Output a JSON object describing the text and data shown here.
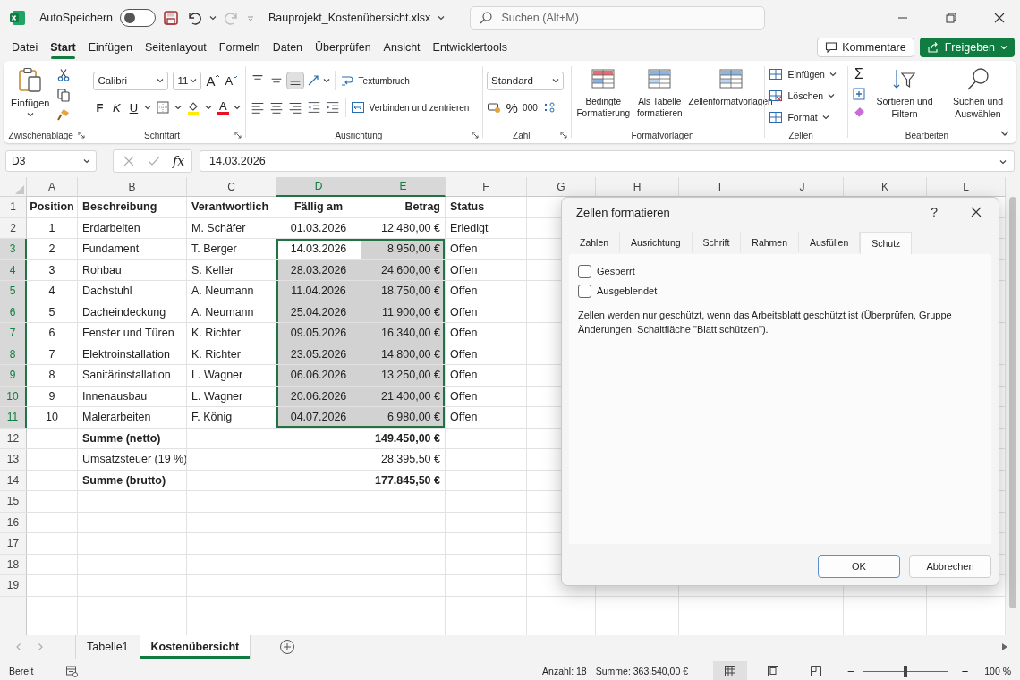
{
  "title_bar": {
    "autosave_label": "AutoSpeichern",
    "autosave_on": false,
    "filename": "Bauprojekt_Kostenübersicht.xlsx",
    "search_placeholder": "Suchen (Alt+M)"
  },
  "menu_tabs": [
    {
      "label": "Datei",
      "selected": false
    },
    {
      "label": "Start",
      "selected": true
    },
    {
      "label": "Einfügen",
      "selected": false
    },
    {
      "label": "Seitenlayout",
      "selected": false
    },
    {
      "label": "Formeln",
      "selected": false
    },
    {
      "label": "Daten",
      "selected": false
    },
    {
      "label": "Überprüfen",
      "selected": false
    },
    {
      "label": "Ansicht",
      "selected": false
    },
    {
      "label": "Entwicklertools",
      "selected": false
    }
  ],
  "comments_button": "Kommentare",
  "share_button": "Freigeben",
  "ribbon": {
    "clipboard": {
      "paste": "Einfügen",
      "label": "Zwischenablage"
    },
    "font": {
      "family": "Calibri",
      "size": "11",
      "grow": "A",
      "shrink": "A",
      "bold": "F",
      "italic": "K",
      "underline": "U",
      "color_letter": "A",
      "label": "Schriftart"
    },
    "alignment": {
      "vertical": [
        {
          "selected": false
        },
        {
          "selected": false
        },
        {
          "selected": true
        }
      ],
      "wrap": "Textumbruch",
      "merge": "Verbinden und zentrieren",
      "label": "Ausrichtung"
    },
    "number": {
      "format": "Standard",
      "percent": "%",
      "thousands": "000",
      "label": "Zahl"
    },
    "styles": {
      "buttons": [
        "Bedingte Formatierung",
        "Als Tabelle formatieren",
        "Zellenformatvorlagen"
      ],
      "label": "Formatvorlagen"
    },
    "cells": {
      "buttons": [
        "Einfügen",
        "Löschen",
        "Format"
      ],
      "label": "Zellen"
    },
    "editing": {
      "autosum": "Σ",
      "buttons": [
        "Sortieren und Filtern",
        "Suchen und Auswählen"
      ],
      "label": "Bearbeiten"
    }
  },
  "formula_bar": {
    "name_box": "D3",
    "fx": "fx",
    "value": "14.03.2026"
  },
  "grid": {
    "columns": [
      {
        "label": "A",
        "selected": false
      },
      {
        "label": "B",
        "selected": false
      },
      {
        "label": "C",
        "selected": false
      },
      {
        "label": "D",
        "selected": true
      },
      {
        "label": "E",
        "selected": true
      },
      {
        "label": "F",
        "selected": false
      },
      {
        "label": "G",
        "selected": false
      },
      {
        "label": "H",
        "selected": false
      },
      {
        "label": "I",
        "selected": false
      },
      {
        "label": "J",
        "selected": false
      },
      {
        "label": "K",
        "selected": false
      },
      {
        "label": "L",
        "selected": false
      }
    ],
    "rows": [
      {
        "number": "1",
        "selected": false,
        "bold": true,
        "cells": [
          "Position",
          "Beschreibung",
          "Verantwortlich",
          "Fällig am",
          "Betrag",
          "Status"
        ]
      },
      {
        "number": "2",
        "selected": false,
        "bold": false,
        "cells": [
          "1",
          "Erdarbeiten",
          "M. Schäfer",
          "01.03.2026",
          "12.480,00 €",
          "Erledigt"
        ]
      },
      {
        "number": "3",
        "selected": true,
        "bold": false,
        "cells": [
          "2",
          "Fundament",
          "T. Berger",
          "14.03.2026",
          "8.950,00 €",
          "Offen"
        ]
      },
      {
        "number": "4",
        "selected": true,
        "bold": false,
        "cells": [
          "3",
          "Rohbau",
          "S. Keller",
          "28.03.2026",
          "24.600,00 €",
          "Offen"
        ]
      },
      {
        "number": "5",
        "selected": true,
        "bold": false,
        "cells": [
          "4",
          "Dachstuhl",
          "A. Neumann",
          "11.04.2026",
          "18.750,00 €",
          "Offen"
        ]
      },
      {
        "number": "6",
        "selected": true,
        "bold": false,
        "cells": [
          "5",
          "Dacheindeckung",
          "A. Neumann",
          "25.04.2026",
          "11.900,00 €",
          "Offen"
        ]
      },
      {
        "number": "7",
        "selected": true,
        "bold": false,
        "cells": [
          "6",
          "Fenster und Türen",
          "K. Richter",
          "09.05.2026",
          "16.340,00 €",
          "Offen"
        ]
      },
      {
        "number": "8",
        "selected": true,
        "bold": false,
        "cells": [
          "7",
          "Elektroinstallation",
          "K. Richter",
          "23.05.2026",
          "14.800,00 €",
          "Offen"
        ]
      },
      {
        "number": "9",
        "selected": true,
        "bold": false,
        "cells": [
          "8",
          "Sanitärinstallation",
          "L. Wagner",
          "06.06.2026",
          "13.250,00 €",
          "Offen"
        ]
      },
      {
        "number": "10",
        "selected": true,
        "bold": false,
        "cells": [
          "9",
          "Innenausbau",
          "L. Wagner",
          "20.06.2026",
          "21.400,00 €",
          "Offen"
        ]
      },
      {
        "number": "11",
        "selected": true,
        "bold": false,
        "cells": [
          "10",
          "Malerarbeiten",
          "F. König",
          "04.07.2026",
          "6.980,00 €",
          "Offen"
        ]
      },
      {
        "number": "12",
        "selected": false,
        "bold": true,
        "cells": [
          "",
          "Summe (netto)",
          "",
          "",
          "149.450,00 €",
          ""
        ]
      },
      {
        "number": "13",
        "selected": false,
        "bold": false,
        "cells": [
          "",
          "Umsatzsteuer (19 %)",
          "",
          "",
          "28.395,50 €",
          ""
        ]
      },
      {
        "number": "14",
        "selected": false,
        "bold": true,
        "cells": [
          "",
          "Summe (brutto)",
          "",
          "",
          "177.845,50 €",
          ""
        ]
      },
      {
        "number": "15",
        "selected": false
      },
      {
        "number": "16",
        "selected": false
      },
      {
        "number": "17",
        "selected": false
      },
      {
        "number": "18",
        "selected": false
      },
      {
        "number": "19",
        "selected": false
      }
    ]
  },
  "dialog": {
    "title": "Zellen formatieren",
    "help": "?",
    "tabs": [
      {
        "label": "Zahlen",
        "selected": false
      },
      {
        "label": "Ausrichtung",
        "selected": false
      },
      {
        "label": "Schrift",
        "selected": false
      },
      {
        "label": "Rahmen",
        "selected": false
      },
      {
        "label": "Ausfüllen",
        "selected": false
      },
      {
        "label": "Schutz",
        "selected": true
      }
    ],
    "checkboxes": [
      {
        "label": "Gesperrt",
        "checked": false
      },
      {
        "label": "Ausgeblendet",
        "checked": false
      }
    ],
    "note": "Zellen werden nur geschützt, wenn das Arbeitsblatt geschützt ist (Überprüfen, Gruppe Änderungen, Schaltfläche \"Blatt schützen\").",
    "buttons": [
      "OK",
      "Abbrechen"
    ]
  },
  "sheet_tabs": [
    {
      "label": "Tabelle1",
      "selected": false
    },
    {
      "label": "Kostenübersicht",
      "selected": true
    }
  ],
  "status_bar": {
    "ready": "Bereit",
    "count": "Anzahl: 18",
    "sum": "Summe: 363.540,00 €",
    "views": [
      {
        "kind": "normal",
        "selected": true
      },
      {
        "kind": "layout",
        "selected": false
      },
      {
        "kind": "pagebreak",
        "selected": false
      }
    ],
    "zoom_out": "−",
    "zoom_in": "+",
    "zoom": {
      "level": 0.5
    },
    "zoom_label": "100 %"
  }
}
